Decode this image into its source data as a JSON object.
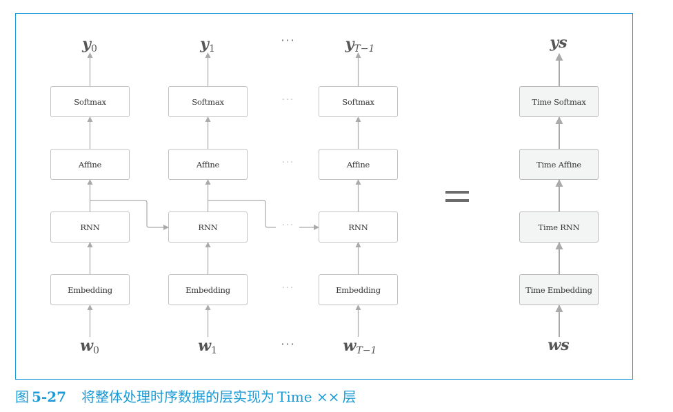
{
  "figure": {
    "caption_prefix": "图",
    "caption_number": "5-27",
    "caption_text_cn": "将整体处理时序数据的层实现为",
    "caption_text_en": "Time ××",
    "caption_suffix": "层",
    "frame_color": "#1a9ad6"
  },
  "columns": [
    {
      "output": {
        "base": "y",
        "sub": "0"
      },
      "input": {
        "base": "w",
        "sub": "0"
      },
      "layers": [
        "Softmax",
        "Affine",
        "RNN",
        "Embedding"
      ]
    },
    {
      "output": {
        "base": "y",
        "sub": "1"
      },
      "input": {
        "base": "w",
        "sub": "1"
      },
      "layers": [
        "Softmax",
        "Affine",
        "RNN",
        "Embedding"
      ]
    },
    {
      "output": {
        "base": "y",
        "sub": "T−1"
      },
      "input": {
        "base": "w",
        "sub": "T−1"
      },
      "layers": [
        "Softmax",
        "Affine",
        "RNN",
        "Embedding"
      ]
    }
  ],
  "ellipsis": "···",
  "equals_sign": "=",
  "time_column": {
    "output": "ys",
    "input": "ws",
    "layers": [
      "Time Softmax",
      "Time Affine",
      "Time RNN",
      "Time Embedding"
    ]
  }
}
